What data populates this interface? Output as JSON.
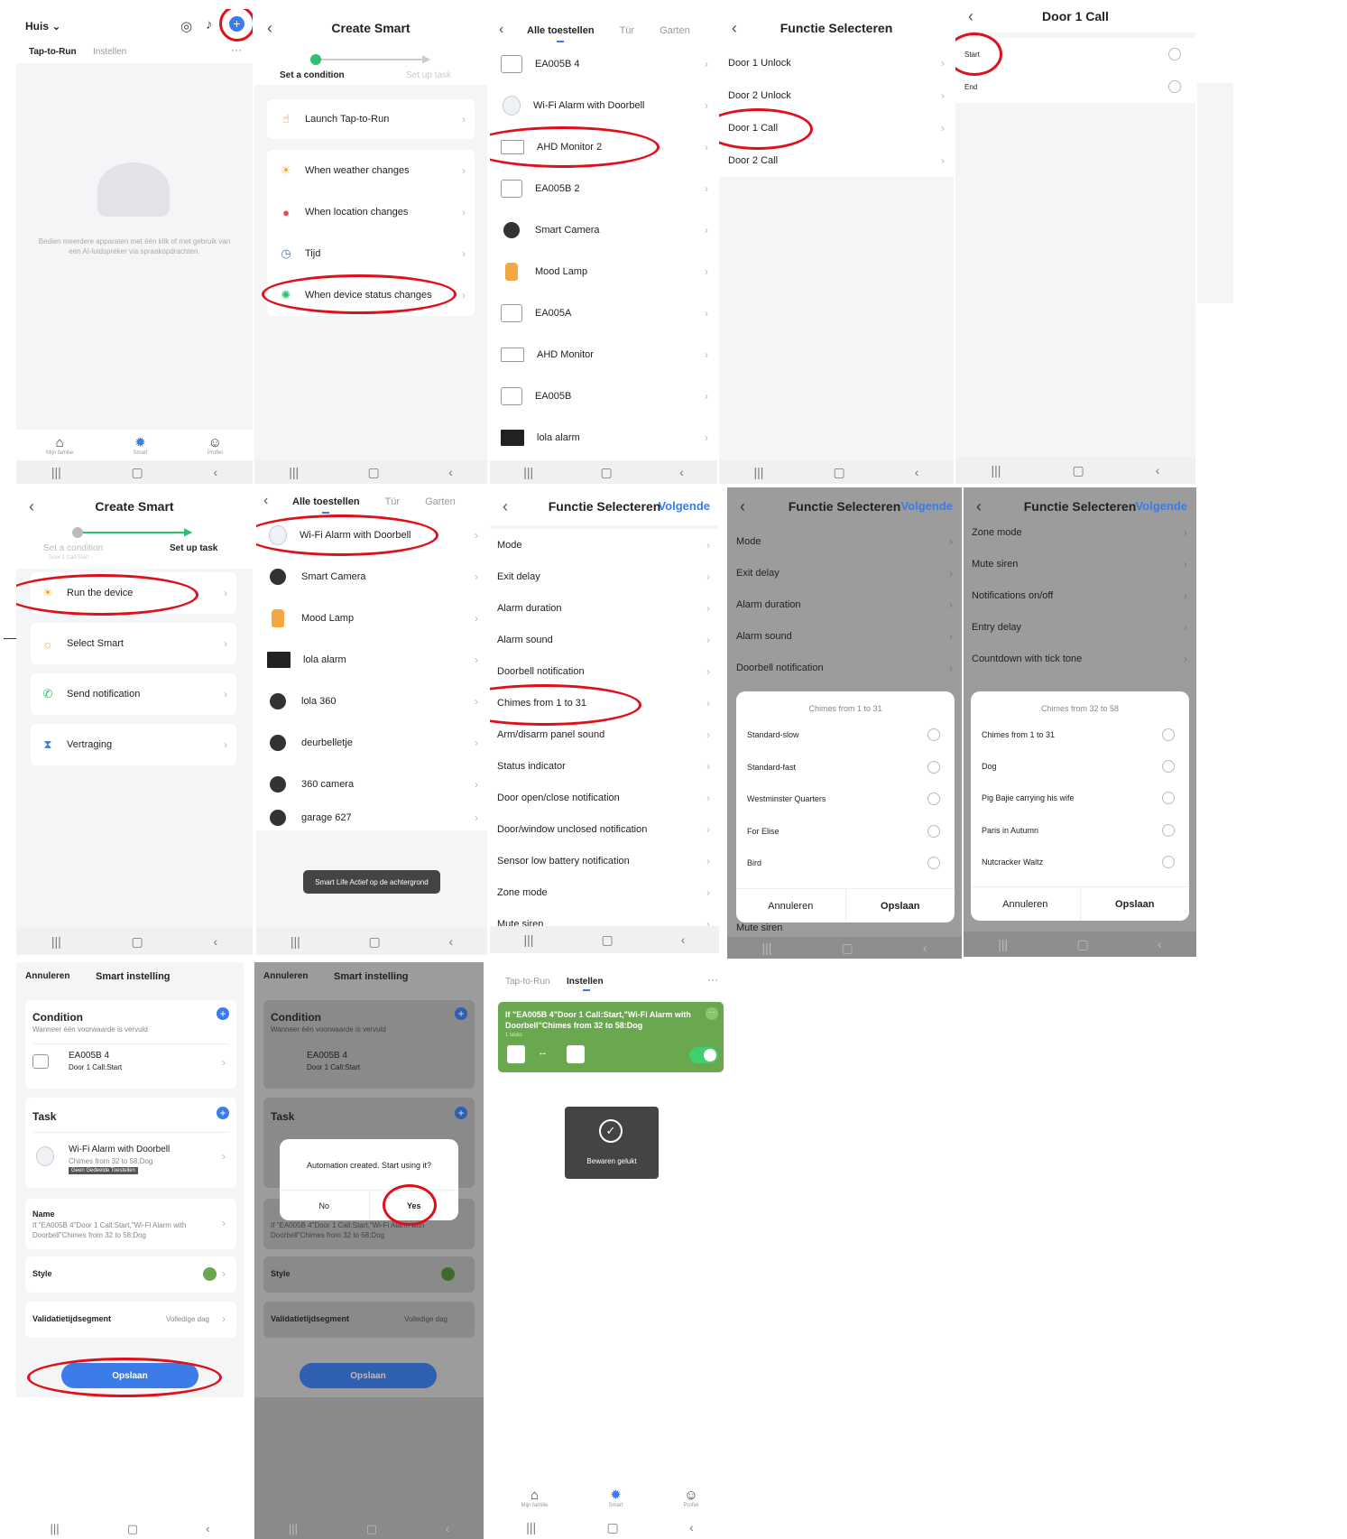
{
  "s1": {
    "home": "Huis",
    "tabs": [
      "Tap-to-Run",
      "Instellen"
    ],
    "empty_text": "Bedien meerdere apparaten met één klik of met gebruik van een AI-luidspreker via spraakopdrachten.",
    "bottom_tabs": [
      "Mijn familie",
      "Smart",
      "Profiel"
    ]
  },
  "s2": {
    "title": "Create Smart",
    "step1": "Set a condition",
    "step2": "Set up task",
    "rows": [
      "Launch Tap-to-Run",
      "When weather changes",
      "When location changes",
      "Tijd",
      "When device status changes"
    ]
  },
  "s3": {
    "tabs": [
      "Alle toestellen",
      "Tür",
      "Garten"
    ],
    "devices": [
      "EA005B 4",
      "Wi-Fi Alarm with Doorbell",
      "AHD Monitor 2",
      "EA005B 2",
      "Smart Camera",
      "Mood Lamp",
      "EA005A",
      "AHD Monitor",
      "EA005B",
      "lola alarm"
    ]
  },
  "s4": {
    "title": "Functie Selecteren",
    "rows": [
      "Door 1 Unlock",
      "Door 2 Unlock",
      "Door 1 Call",
      "Door 2 Call"
    ]
  },
  "s5": {
    "title": "Door 1 Call",
    "rows": [
      "Start",
      "End"
    ]
  },
  "s6": {
    "title": "Create Smart",
    "step1": "Set a condition",
    "step1_sub": "Door 1 Call:Start",
    "step2": "Set up task",
    "rows": [
      "Run the device",
      "Select Smart",
      "Send notification",
      "Vertraging"
    ]
  },
  "s7": {
    "tabs": [
      "Alle toestellen",
      "Tür",
      "Garten"
    ],
    "devices": [
      "Wi-Fi Alarm with Doorbell",
      "Smart Camera",
      "Mood Lamp",
      "lola alarm",
      "lola 360",
      "deurbelletje",
      "360 camera",
      "garage 627"
    ],
    "toast": "Smart Life Actief op de achtergrond"
  },
  "s8": {
    "title": "Functie Selecteren",
    "next": "Volgende",
    "rows": [
      "Mode",
      "Exit delay",
      "Alarm duration",
      "Alarm sound",
      "Doorbell notification",
      "Chimes from 1 to 31",
      "Arm/disarm panel sound",
      "Status indicator",
      "Door open/close notification",
      "Door/window unclosed notification",
      "Sensor low battery notification",
      "Zone mode",
      "Mute siren"
    ]
  },
  "s9": {
    "title": "Functie Selecteren",
    "next": "Volgende",
    "rows": [
      "Mode",
      "Exit delay",
      "Alarm duration",
      "Alarm sound",
      "Doorbell notification"
    ],
    "bottom_row": "Mute siren",
    "sheet_title": "Chimes from 1 to 31",
    "options": [
      "Standard-slow",
      "Standard-fast",
      "Westminster Quarters",
      "For Elise",
      "Bird"
    ],
    "cancel": "Annuleren",
    "save": "Opslaan"
  },
  "s10": {
    "title": "Functie Selecteren",
    "next": "Volgende",
    "rows": [
      "Zone mode",
      "Mute siren",
      "Notifications on/off",
      "Entry delay",
      "Countdown with tick tone"
    ],
    "sheet_title": "Chimes from 32 to 58",
    "options": [
      "Chimes from 1 to 31",
      "Dog",
      "Pig Bajie carrying his wife",
      "Paris in Autumn",
      "Nutcracker Waltz"
    ],
    "cancel": "Annuleren",
    "save": "Opslaan"
  },
  "s11": {
    "cancel": "Annuleren",
    "title": "Smart instelling",
    "condition": "Condition",
    "condition_sub": "Wanneer één voorwaarde is vervuld",
    "cond_device": "EA005B 4",
    "cond_value": "Door 1 Call:Start",
    "task": "Task",
    "task_device": "Wi-Fi Alarm with Doorbell",
    "task_value": "Chimes from 32 to 58:Dog",
    "task_badge": "Geen Gedeelde Toestellen",
    "name_label": "Name",
    "name_value": "If \"EA005B 4\"Door 1 Call:Start,\"Wi-Fi Alarm with Doorbell\"Chimes from 32 to 58:Dog",
    "style": "Style",
    "validity": "Validatietijdsegment",
    "validity_value": "Volledige dag",
    "save": "Opslaan"
  },
  "s12": {
    "cancel": "Annuleren",
    "title": "Smart instelling",
    "condition": "Condition",
    "condition_sub": "Wanneer één voorwaarde is vervuld",
    "cond_device": "EA005B 4",
    "cond_value": "Door 1 Call:Start",
    "task": "Task",
    "dialog_text": "Automation created. Start using it?",
    "no": "No",
    "yes": "Yes",
    "name_value": "If \"EA005B 4\"Door 1 Call:Start,\"Wi-Fi Alarm with Doorbell\"Chimes from 32 to 58:Dog",
    "style": "Style",
    "validity": "Validatietijdsegment",
    "validity_value": "Volledige dag",
    "save": "Opslaan"
  },
  "s13": {
    "tabs": [
      "Tap-to-Run",
      "Instellen"
    ],
    "card_title": "If \"EA005B 4\"Door 1 Call:Start,\"Wi-Fi Alarm with Doorbell\"Chimes from 32 to 58:Dog",
    "card_sub": "1 tasks",
    "toast": "Bewaren gelukt",
    "bottom_tabs": [
      "Mijn familie",
      "Smart",
      "Profiel"
    ]
  },
  "colors": {
    "accent": "#3b7ce8",
    "highlight": "#e0101a",
    "card_green": "#6aa84f"
  }
}
